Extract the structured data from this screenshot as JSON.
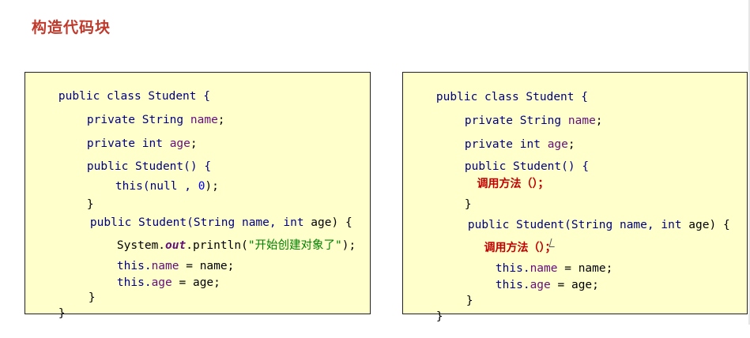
{
  "page": {
    "title": "构造代码块"
  },
  "left_code": {
    "l1": {
      "a": "public class Student {"
    },
    "l2": {
      "a": "private String ",
      "b": "name",
      "c": ";"
    },
    "l3": {
      "a": "private int ",
      "b": "age",
      "c": ";"
    },
    "l4": {
      "a": "public Student() {"
    },
    "l5": {
      "a": "this(null , ",
      "b": "0",
      "c": ");"
    },
    "l6": {
      "a": "}"
    },
    "l7": {
      "a": "public Student(String name, ",
      "b": "int",
      "c": " age) {"
    },
    "l8": {
      "a": "System.",
      "b": "out",
      "c": ".println(",
      "d": "\"开始创建对象了\"",
      "e": ");"
    },
    "l9": {
      "a": "this.",
      "b": "name",
      "c": " = name;"
    },
    "l10": {
      "a": "this.",
      "b": "age",
      "c": " = age;"
    },
    "l11": {
      "a": "}"
    },
    "l12": {
      "a": "}"
    }
  },
  "right_code": {
    "l1": {
      "a": "public class Student {"
    },
    "l2": {
      "a": "private String ",
      "b": "name",
      "c": ";"
    },
    "l3": {
      "a": "private int ",
      "b": "age",
      "c": ";"
    },
    "l4": {
      "a": "public Student() {"
    },
    "l5": {
      "a": "调用方法（）；"
    },
    "l6": {
      "a": "}"
    },
    "l7": {
      "a": "public Student(String name, ",
      "b": "int",
      "c": " age) {"
    },
    "l8": {
      "a": "调用方法（）；"
    },
    "l9": {
      "a": "this.",
      "b": "name",
      "c": " = name;"
    },
    "l10": {
      "a": "this.",
      "b": "age",
      "c": " = age;"
    },
    "l11": {
      "a": "}"
    },
    "l12": {
      "a": "}"
    }
  }
}
